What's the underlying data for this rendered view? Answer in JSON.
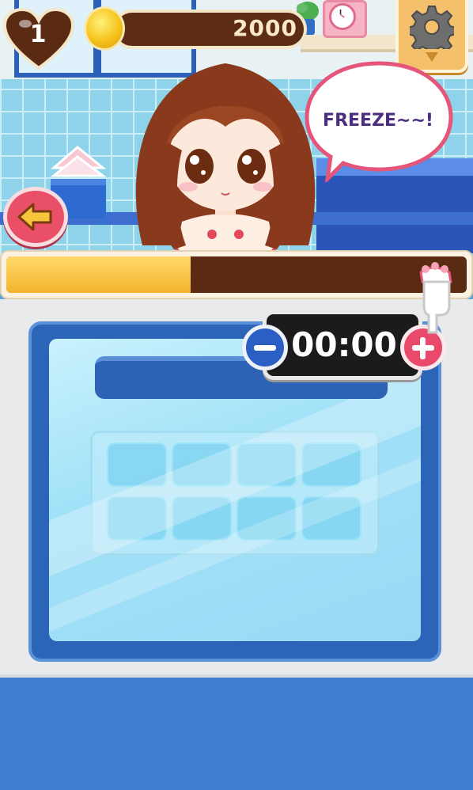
{
  "hud": {
    "lives": "1",
    "coins": "2000",
    "icons": [
      "heart-icon",
      "coin-icon",
      "gear-icon",
      "back-arrow-icon"
    ]
  },
  "speech": {
    "text": "FREEZE~~!"
  },
  "progress": {
    "fraction": 0.4
  },
  "timer": {
    "display": "00:00"
  },
  "colors": {
    "brown": "#5a2a12",
    "gold": "#f4b42c",
    "pink": "#e94a6b",
    "blue": "#2c64b8"
  }
}
